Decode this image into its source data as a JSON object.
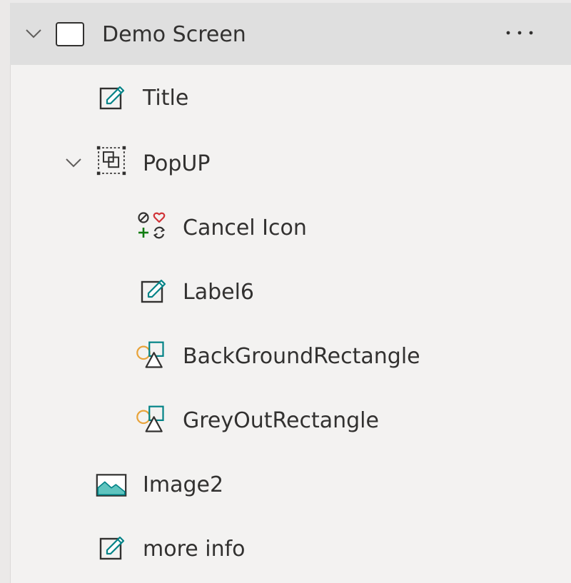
{
  "tree": {
    "screen": {
      "label": "Demo Screen",
      "more_label": "...",
      "icon": "screen-icon",
      "expanded": true
    },
    "items": [
      {
        "label": "Title",
        "icon": "label-icon",
        "level": 1
      },
      {
        "label": "PopUP",
        "icon": "group-icon",
        "level": 1,
        "expanded": true
      },
      {
        "label": "Cancel Icon",
        "icon": "icons-control-icon",
        "level": 2
      },
      {
        "label": "Label6",
        "icon": "label-icon",
        "level": 2
      },
      {
        "label": "BackGroundRectangle",
        "icon": "shape-icon",
        "level": 2
      },
      {
        "label": "GreyOutRectangle",
        "icon": "shape-icon",
        "level": 2
      },
      {
        "label": "Image2",
        "icon": "image-icon",
        "level": 1
      },
      {
        "label": "more info",
        "icon": "label-icon",
        "level": 1
      }
    ]
  },
  "colors": {
    "selected_row": "#dfdfdf",
    "panel": "#f3f2f1",
    "accent_teal": "#038387",
    "shape_orange": "#e8a33a",
    "icon_red": "#d13438",
    "icon_green": "#107c10"
  }
}
